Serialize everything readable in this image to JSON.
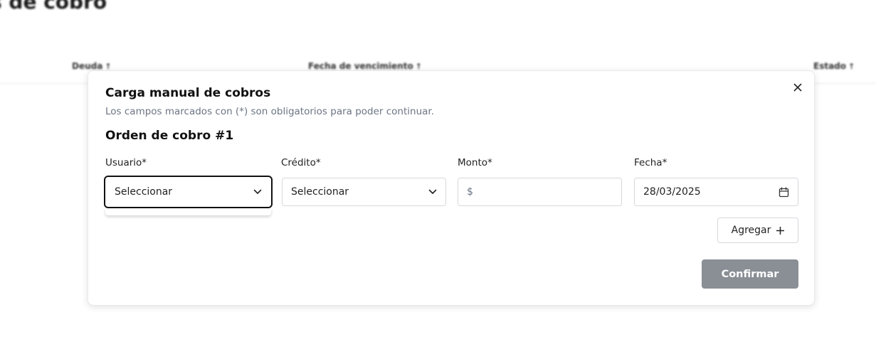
{
  "background": {
    "page_title": "s de cobro",
    "table_headers": [
      {
        "label": "Deuda",
        "arrow": "↑"
      },
      {
        "label": "Fecha de vencimiento",
        "arrow": "↑"
      },
      {
        "label": "Estado",
        "arrow": "↑"
      }
    ]
  },
  "modal": {
    "title": "Carga manual de cobros",
    "subtitle": "Los campos marcados con (*) son obligatorios para poder continuar.",
    "order_title": "Orden de cobro #1",
    "fields": {
      "usuario": {
        "label": "Usuario*",
        "value": "Seleccionar"
      },
      "credito": {
        "label": "Crédito*",
        "value": "Seleccionar"
      },
      "monto": {
        "label": "Monto*",
        "prefix": "$",
        "value": ""
      },
      "fecha": {
        "label": "Fecha*",
        "value": "28/03/2025"
      }
    },
    "add_button": "Agregar",
    "confirm_button": "Confirmar"
  },
  "icons": {
    "close": "close-icon",
    "chevron": "chevron-down-icon",
    "calendar": "calendar-icon",
    "plus": "plus-icon"
  },
  "colors": {
    "confirm_disabled": "#8a8e95",
    "subtitle": "#6b7584",
    "focus_border": "#111111"
  }
}
